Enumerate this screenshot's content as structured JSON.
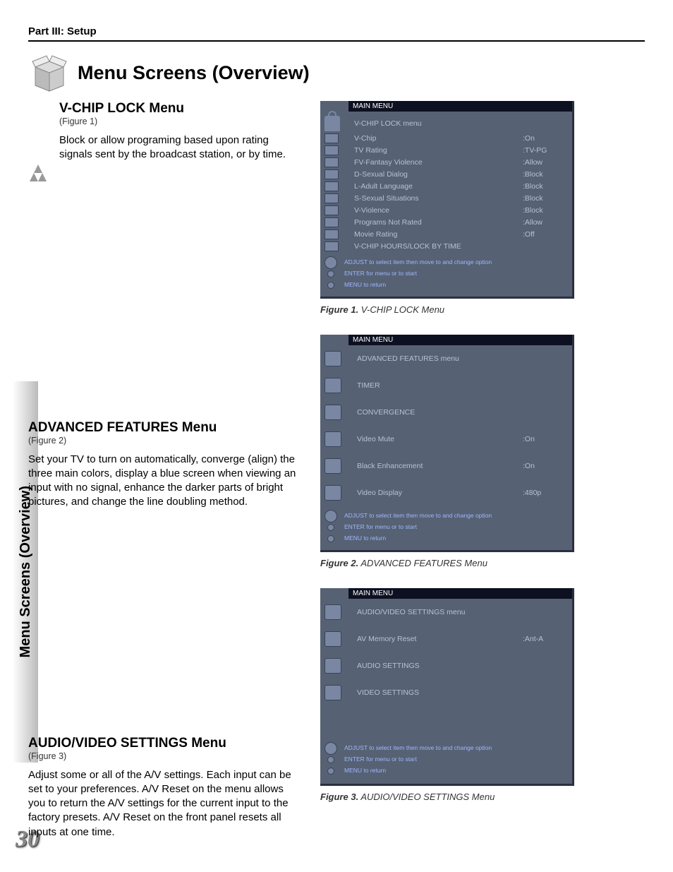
{
  "header": {
    "part": "Part III: Setup"
  },
  "page_title": "Menu Screens (Overview)",
  "side_tab": "Menu Screens (Overview)",
  "page_number": "30",
  "sections": {
    "vchip": {
      "heading": "V-CHIP LOCK Menu",
      "fig_ref": "(Figure 1)",
      "body": "Block or allow programing based upon rating signals sent by the broadcast station, or by time."
    },
    "advanced": {
      "heading": "ADVANCED FEATURES Menu",
      "fig_ref": "(Figure 2)",
      "body": "Set your TV to turn on automatically, converge (align) the three main colors, display a blue screen when viewing an input with no signal, enhance the darker parts of bright pictures, and change the line doubling method."
    },
    "av": {
      "heading": "AUDIO/VIDEO SETTINGS Menu",
      "fig_ref": "(Figure 3)",
      "body": "Adjust some or all of the A/V settings.  Each input can be set to your preferences.  A/V Reset on the menu allows you to return the A/V settings for the current input to the factory presets.  A/V Reset on the front panel resets all inputs at one time."
    }
  },
  "captions": {
    "fig1_b": "Figure 1.",
    "fig1_r": "  V-CHIP LOCK  Menu",
    "fig2_b": "Figure 2.",
    "fig2_r": "  ADVANCED FEATURES Menu",
    "fig3_b": "Figure 3.",
    "fig3_r": "  AUDIO/VIDEO SETTINGS Menu"
  },
  "menus": {
    "common": {
      "title": "MAIN MENU",
      "hint1": "ADJUST to select item then move to and change option",
      "hint2": "ENTER for menu or to start",
      "hint3": "MENU to return"
    },
    "vchip": {
      "subtitle": "V-CHIP LOCK menu",
      "rows": [
        {
          "label": "V-Chip",
          "value": ":On"
        },
        {
          "label": "TV Rating",
          "value": ":TV-PG"
        },
        {
          "label": "FV-Fantasy Violence",
          "value": ":Allow"
        },
        {
          "label": "D-Sexual Dialog",
          "value": ":Block"
        },
        {
          "label": "L-Adult Language",
          "value": ":Block"
        },
        {
          "label": "S-Sexual Situations",
          "value": ":Block"
        },
        {
          "label": "V-Violence",
          "value": ":Block"
        },
        {
          "label": "Programs Not Rated",
          "value": ":Allow"
        },
        {
          "label": "Movie Rating",
          "value": ":Off"
        },
        {
          "label": "V-CHIP HOURS/LOCK BY TIME",
          "value": ""
        }
      ]
    },
    "advanced": {
      "subtitle": "ADVANCED FEATURES menu",
      "rows": [
        {
          "label": "TIMER",
          "value": ""
        },
        {
          "label": "CONVERGENCE",
          "value": ""
        },
        {
          "label": "Video Mute",
          "value": ":On"
        },
        {
          "label": "Black Enhancement",
          "value": ":On"
        },
        {
          "label": "Video Display",
          "value": ":480p"
        }
      ]
    },
    "av": {
      "subtitle": "AUDIO/VIDEO SETTINGS menu",
      "rows": [
        {
          "label": "AV Memory Reset",
          "value": ":Ant-A"
        },
        {
          "label": "AUDIO SETTINGS",
          "value": ""
        },
        {
          "label": "VIDEO SETTINGS",
          "value": ""
        }
      ]
    }
  }
}
